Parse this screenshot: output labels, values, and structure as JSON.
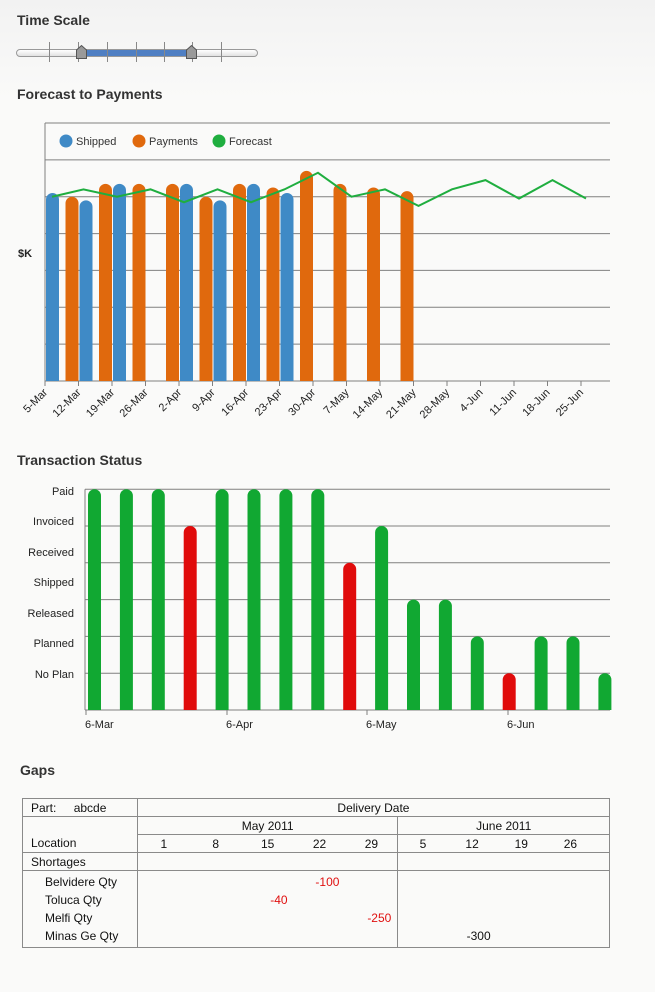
{
  "time_scale": {
    "title": "Time Scale",
    "range_start_fraction": 0.27,
    "range_end_fraction": 0.73
  },
  "forecast_title": "Forecast to Payments",
  "transaction_title": "Transaction Status",
  "gaps_title": "Gaps",
  "colors": {
    "shipped": "#3f8ac6",
    "payments": "#e0690d",
    "forecast": "#1fae3f",
    "status_ok": "#11a832",
    "status_late": "#e00b0b",
    "negative": "#e01010"
  },
  "chart_data": [
    {
      "type": "bar",
      "title": "Forecast to Payments",
      "ylabel": "$K",
      "xlabel": "",
      "ylim": [
        0,
        7
      ],
      "grid": true,
      "legend": "top-left",
      "categories": [
        "5-Mar",
        "12-Mar",
        "19-Mar",
        "26-Mar",
        "2-Apr",
        "9-Apr",
        "16-Apr",
        "23-Apr",
        "30-Apr",
        "7-May",
        "14-May",
        "21-May",
        "28-May",
        "4-Jun",
        "11-Jun",
        "18-Jun",
        "25-Jun"
      ],
      "series": [
        {
          "name": "Shipped",
          "type": "bar",
          "values": [
            5.1,
            4.9,
            5.35,
            null,
            5.35,
            4.9,
            5.35,
            5.1,
            null,
            null,
            null,
            null,
            null,
            null,
            null,
            null,
            null
          ]
        },
        {
          "name": "Payments",
          "type": "bar",
          "values": [
            null,
            5.0,
            5.35,
            5.35,
            5.35,
            5.0,
            5.35,
            5.25,
            5.7,
            5.35,
            5.25,
            5.15,
            null,
            null,
            null,
            null,
            null
          ]
        },
        {
          "name": "Forecast",
          "type": "line",
          "values": [
            5.0,
            5.2,
            5.0,
            5.2,
            4.85,
            5.2,
            4.85,
            5.2,
            5.65,
            5.0,
            5.2,
            4.75,
            5.2,
            5.45,
            4.95,
            5.45,
            4.95
          ]
        }
      ]
    },
    {
      "type": "bar",
      "title": "Transaction Status",
      "xlabel": "",
      "ylabel": "",
      "grid": true,
      "y_categories": [
        "No Plan",
        "Planned",
        "Released",
        "Shipped",
        "Received",
        "Invoiced",
        "Paid"
      ],
      "ylim": [
        0,
        6
      ],
      "x_tick_labels": [
        "6-Mar",
        "6-Apr",
        "6-May",
        "6-Jun"
      ],
      "bars": [
        {
          "level": 6,
          "status": "ok"
        },
        {
          "level": 6,
          "status": "ok"
        },
        {
          "level": 6,
          "status": "ok"
        },
        {
          "level": 5,
          "status": "late"
        },
        {
          "level": 6,
          "status": "ok"
        },
        {
          "level": 6,
          "status": "ok"
        },
        {
          "level": 6,
          "status": "ok"
        },
        {
          "level": 6,
          "status": "ok"
        },
        {
          "level": 4,
          "status": "late"
        },
        {
          "level": 5,
          "status": "ok"
        },
        {
          "level": 3,
          "status": "ok"
        },
        {
          "level": 3,
          "status": "ok"
        },
        {
          "level": 2,
          "status": "ok"
        },
        {
          "level": 1,
          "status": "late"
        },
        {
          "level": 2,
          "status": "ok"
        },
        {
          "level": 2,
          "status": "ok"
        },
        {
          "level": 1,
          "status": "ok"
        }
      ]
    }
  ],
  "gaps": {
    "part_label": "Part:",
    "part_value": "abcde",
    "delivery_date_label": "Delivery Date",
    "location_label": "Location",
    "shortages_label": "Shortages",
    "months": [
      {
        "label": "May 2011",
        "days": [
          "1",
          "8",
          "15",
          "22",
          "29"
        ]
      },
      {
        "label": "June 2011",
        "days": [
          "5",
          "12",
          "19",
          "26"
        ]
      }
    ],
    "rows": [
      {
        "label": "Belvidere Qty",
        "may": [
          "",
          "",
          "",
          "-100",
          ""
        ],
        "june": [
          "",
          "",
          "",
          ""
        ],
        "red": true
      },
      {
        "label": "Toluca Qty",
        "may": [
          "",
          "",
          "-40",
          "",
          ""
        ],
        "june": [
          "",
          "",
          "",
          ""
        ],
        "red": true
      },
      {
        "label": "Melfi Qty",
        "may": [
          "",
          "",
          "",
          "",
          "-250"
        ],
        "june": [
          "",
          "",
          "",
          ""
        ],
        "red": true
      },
      {
        "label": "Minas Ge Qty",
        "may": [
          "",
          "",
          "",
          "",
          ""
        ],
        "june": [
          "",
          "-300",
          "",
          ""
        ],
        "red": false
      }
    ]
  }
}
